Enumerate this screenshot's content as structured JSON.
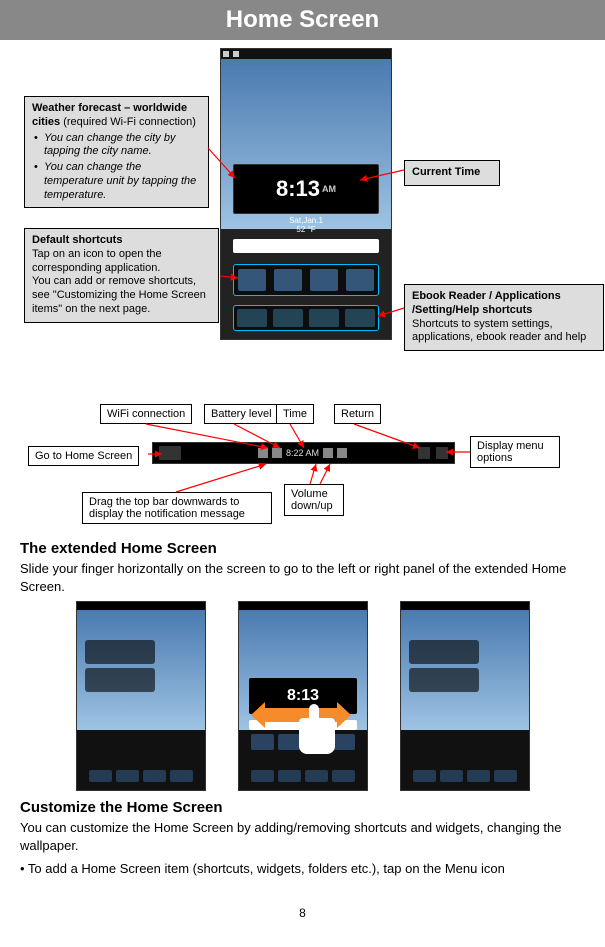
{
  "title": "Home Screen",
  "callouts": {
    "weather": {
      "heading_bold": "Weather forecast – worldwide cities",
      "heading_rest": " (required Wi-Fi connection)",
      "bullets": [
        "You can change the city by tapping the city name.",
        "You can change the temperature unit by tapping the temperature."
      ]
    },
    "default_shortcuts": {
      "heading": "Default shortcuts",
      "body": "Tap on an icon to open the corresponding application.\nYou can add or remove shortcuts, see \"Customizing the Home Screen items\" on the next page."
    },
    "current_time": "Current Time",
    "ebook": {
      "heading": "Ebook Reader / Applications /Setting/Help shortcuts",
      "body": "Shortcuts to system settings, applications, ebook reader and help"
    }
  },
  "screenshot": {
    "clock": "8:13",
    "ampm": "AM",
    "date": "Sat,Jan.1\n52 °F"
  },
  "statusbar_labels": {
    "wifi": "WiFi connection",
    "battery": "Battery level",
    "time": "Time",
    "return": "Return",
    "go_home": "Go to Home Screen",
    "display_menu": "Display menu options",
    "drag": "Drag the top bar downwards to display the notification message",
    "volume": "Volume down/up"
  },
  "statusbar_time": "8:22 AM",
  "sections": {
    "extended": {
      "heading": "The extended Home Screen",
      "body": "Slide your finger horizontally on the screen to go to the left or right panel of the extended Home Screen."
    },
    "customize": {
      "heading": "Customize the Home Screen",
      "body1": "You can customize the Home Screen by adding/removing shortcuts and widgets, changing the wallpaper.",
      "body2": "• To add a Home Screen item (shortcuts, widgets, folders etc.), tap on the Menu icon"
    }
  },
  "panel_clock": "8:13",
  "page_number": "8"
}
